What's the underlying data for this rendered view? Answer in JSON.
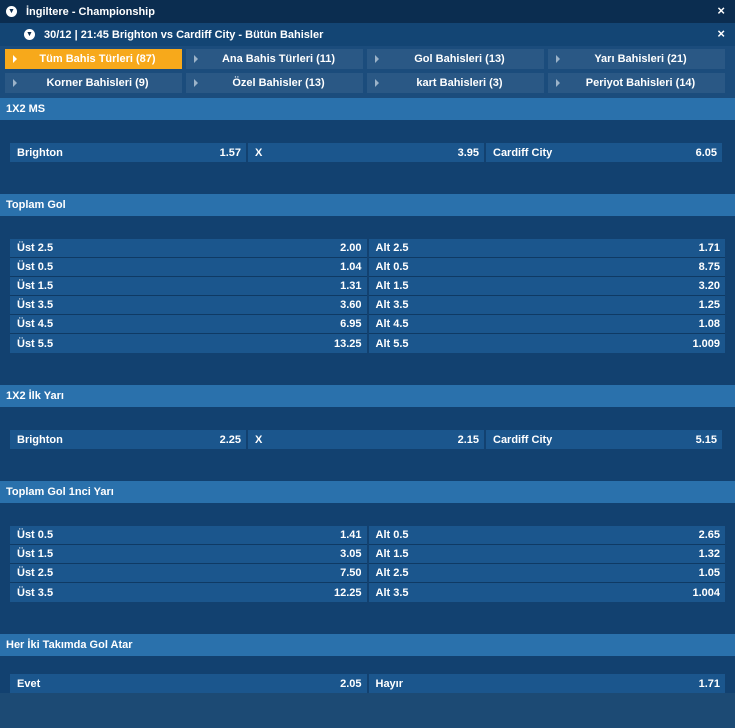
{
  "header": {
    "title": "İngiltere - Championship",
    "close_icon": "×"
  },
  "subheader": {
    "title": "30/12 | 21:45 Brighton vs Cardiff City - Bütün Bahisler",
    "close_icon": "×"
  },
  "tabs_row1": [
    {
      "label": "Tüm Bahis Türleri (87)",
      "active": true
    },
    {
      "label": "Ana Bahis Türleri (11)"
    },
    {
      "label": "Gol Bahisleri (13)"
    },
    {
      "label": "Yarı Bahisleri (21)"
    }
  ],
  "tabs_row2": [
    {
      "label": "Korner Bahisleri (9)"
    },
    {
      "label": "Özel Bahisler (13)"
    },
    {
      "label": "kart Bahisleri (3)"
    },
    {
      "label": "Periyot Bahisleri (14)"
    }
  ],
  "colors": {
    "active_tab": "#f7a91b",
    "section_header": "#2a71ac",
    "cell": "#1b568d"
  },
  "sections": {
    "ms": {
      "title": "1X2 MS",
      "row": [
        {
          "name": "Brighton",
          "odd": "1.57"
        },
        {
          "name": "X",
          "odd": "3.95"
        },
        {
          "name": "Cardiff City",
          "odd": "6.05"
        }
      ]
    },
    "total": {
      "title": "Toplam Gol",
      "rows": [
        [
          {
            "name": "Üst 2.5",
            "odd": "2.00"
          },
          {
            "name": "Alt 2.5",
            "odd": "1.71"
          }
        ],
        [
          {
            "name": "Üst 0.5",
            "odd": "1.04"
          },
          {
            "name": "Alt 0.5",
            "odd": "8.75"
          }
        ],
        [
          {
            "name": "Üst 1.5",
            "odd": "1.31"
          },
          {
            "name": "Alt 1.5",
            "odd": "3.20"
          }
        ],
        [
          {
            "name": "Üst 3.5",
            "odd": "3.60"
          },
          {
            "name": "Alt 3.5",
            "odd": "1.25"
          }
        ],
        [
          {
            "name": "Üst 4.5",
            "odd": "6.95"
          },
          {
            "name": "Alt 4.5",
            "odd": "1.08"
          }
        ],
        [
          {
            "name": "Üst 5.5",
            "odd": "13.25"
          },
          {
            "name": "Alt 5.5",
            "odd": "1.009"
          }
        ]
      ]
    },
    "ht": {
      "title": "1X2 İlk Yarı",
      "row": [
        {
          "name": "Brighton",
          "odd": "2.25"
        },
        {
          "name": "X",
          "odd": "2.15"
        },
        {
          "name": "Cardiff City",
          "odd": "5.15"
        }
      ]
    },
    "total_ht": {
      "title": "Toplam Gol 1nci Yarı",
      "rows": [
        [
          {
            "name": "Üst 0.5",
            "odd": "1.41"
          },
          {
            "name": "Alt 0.5",
            "odd": "2.65"
          }
        ],
        [
          {
            "name": "Üst 1.5",
            "odd": "3.05"
          },
          {
            "name": "Alt 1.5",
            "odd": "1.32"
          }
        ],
        [
          {
            "name": "Üst 2.5",
            "odd": "7.50"
          },
          {
            "name": "Alt 2.5",
            "odd": "1.05"
          }
        ],
        [
          {
            "name": "Üst 3.5",
            "odd": "12.25"
          },
          {
            "name": "Alt 3.5",
            "odd": "1.004"
          }
        ]
      ]
    },
    "btts": {
      "title": "Her İki Takımda Gol Atar",
      "row": [
        {
          "name": "Evet",
          "odd": "2.05"
        },
        {
          "name": "Hayır",
          "odd": "1.71"
        }
      ]
    }
  }
}
